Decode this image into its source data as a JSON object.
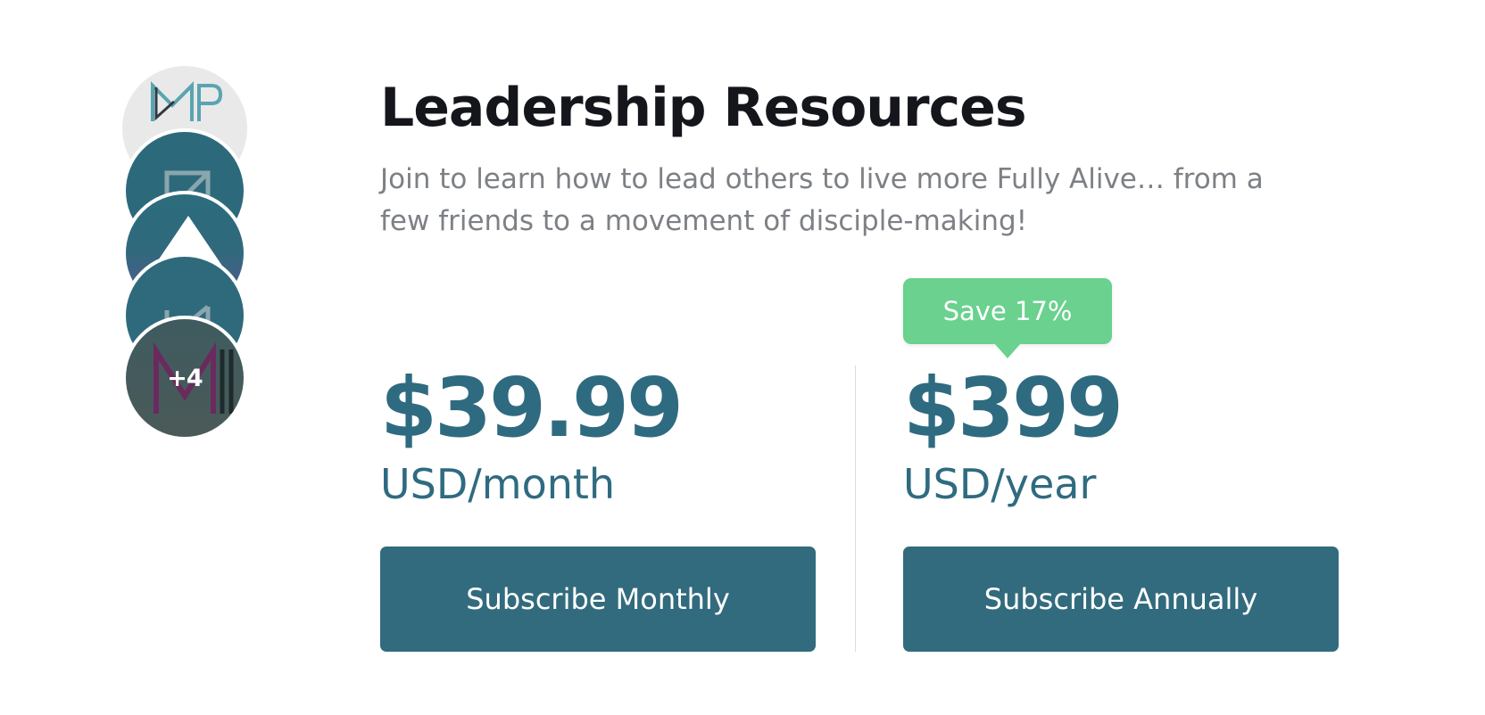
{
  "header": {
    "title": "Leadership Resources",
    "description": "Join to learn how to lead others to live more Fully Alive… from a few friends to a movement of disciple-making!"
  },
  "avatars": {
    "items": [
      {
        "name": "dmp-logo-icon"
      },
      {
        "name": "group-logo-icon"
      },
      {
        "name": "mountain-logo-icon"
      },
      {
        "name": "group-logo-icon"
      },
      {
        "name": "m-logo-icon"
      }
    ],
    "more_count": "+4"
  },
  "plans": {
    "monthly": {
      "price": "$39.99",
      "period": "USD/month",
      "button_label": "Subscribe Monthly"
    },
    "annual": {
      "badge": "Save 17%",
      "price": "$399",
      "period": "USD/year",
      "button_label": "Subscribe Annually"
    }
  },
  "colors": {
    "accent": "#326b7d",
    "price_text": "#2f6b80",
    "badge": "#6ad18e",
    "title": "#14161b",
    "description": "#7d8085"
  }
}
